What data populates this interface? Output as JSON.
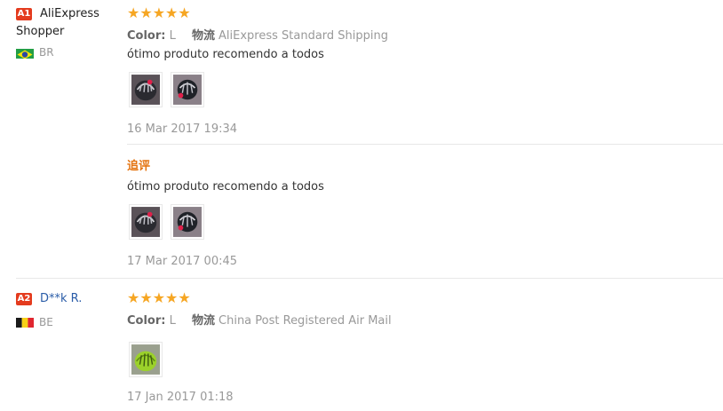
{
  "reviews": [
    {
      "badge": "A1",
      "username": "AliExpress Shopper",
      "country": "BR",
      "stars": "★★★★★",
      "color_label": "Color:",
      "color_value": "L",
      "shipping_label": "物流",
      "shipping_value": "AliExpress Standard Shipping",
      "text": "ótimo produto recomendo a todos",
      "date": "16 Mar 2017 19:34",
      "followup": {
        "label": "追评",
        "text": "ótimo produto recomendo a todos",
        "date": "17 Mar 2017 00:45"
      }
    },
    {
      "badge": "A2",
      "username": "D**k R.",
      "country": "BE",
      "stars": "★★★★★",
      "color_label": "Color:",
      "color_value": "L",
      "shipping_label": "物流",
      "shipping_value": "China Post Registered Air Mail",
      "date": "17 Jan 2017 01:18"
    }
  ],
  "colors": {
    "badge": "#e43b1e",
    "star": "#f6a623",
    "followup": "#e4730f",
    "link": "#2a5ca8"
  }
}
